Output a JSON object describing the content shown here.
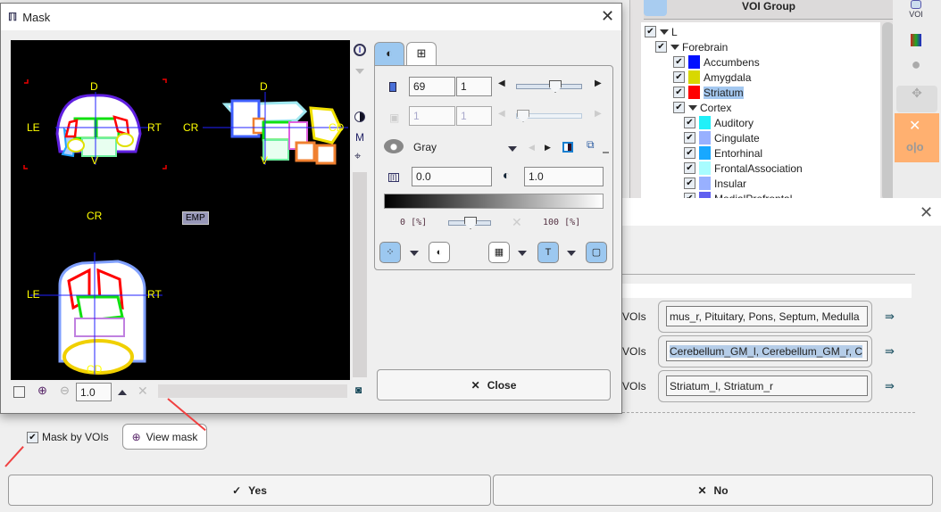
{
  "voi_panel": {
    "header": "VOI Group",
    "tree": [
      {
        "label": "L",
        "level": 0,
        "checked": true,
        "expanded": true
      },
      {
        "label": "Forebrain",
        "level": 1,
        "checked": true,
        "expanded": true
      },
      {
        "label": "Accumbens",
        "level": 2,
        "checked": true,
        "color": "#0010ff"
      },
      {
        "label": "Amygdala",
        "level": 2,
        "checked": true,
        "color": "#d8d800"
      },
      {
        "label": "Striatum",
        "level": 2,
        "checked": true,
        "color": "#ff0000",
        "selected": true
      },
      {
        "label": "Cortex",
        "level": 2,
        "checked": true,
        "expanded": true
      },
      {
        "label": "Auditory",
        "level": 3,
        "checked": true,
        "color": "#20f0f8"
      },
      {
        "label": "Cingulate",
        "level": 3,
        "checked": true,
        "color": "#98b0ff"
      },
      {
        "label": "Entorhinal",
        "level": 3,
        "checked": true,
        "color": "#18a8ff"
      },
      {
        "label": "FrontalAssociation",
        "level": 3,
        "checked": true,
        "color": "#a8fcff"
      },
      {
        "label": "Insular",
        "level": 3,
        "checked": true,
        "color": "#98b0ff"
      },
      {
        "label": "MedialPrefrontal",
        "level": 3,
        "checked": true,
        "color": "#6060f0"
      }
    ],
    "side_icons": [
      "voi-icon",
      "colormap-icon",
      "brain-icon",
      "move-voi-icon",
      "delete-icon",
      "split-icon"
    ],
    "voi_icon_label": "VOI",
    "highlight_color": "#ffb070"
  },
  "bg_dialog": {
    "voi_rows": [
      {
        "label": "VOIs",
        "value": "mus_r, Pituitary, Pons, Septum, Medulla",
        "highlighted": false
      },
      {
        "label": "VOIs",
        "value": "Cerebellum_GM_l, Cerebellum_GM_r, C",
        "highlighted": true
      },
      {
        "label": "VOIs",
        "value": "Striatum_l, Striatum_r",
        "highlighted": false
      }
    ],
    "mask_by_vois_label": "Mask by VOIs",
    "mask_by_vois_checked": true,
    "view_mask_label": "View mask",
    "yes_label": "Yes",
    "no_label": "No"
  },
  "mask_dialog": {
    "title": "Mask",
    "viewer": {
      "coronal": {
        "top": "D",
        "bottom": "V",
        "left": "LE",
        "right": "RT"
      },
      "sagittal": {
        "top": "D",
        "bottom": "V",
        "left": "CR",
        "right": "CD"
      },
      "axial": {
        "top": "CR",
        "bottom": "CD",
        "left": "LE",
        "right": "RT"
      },
      "empty_badge": "EMP"
    },
    "right_strip_m": "M",
    "zoom_value": "1.0",
    "panel": {
      "slice_value": "69",
      "slice_step": "1",
      "slice_slider": 0.6,
      "frame_value": "1",
      "frame_step": "1",
      "frame_slider": 0.0,
      "colormap": "Gray",
      "min_value": "0.0",
      "max_value": "1.0",
      "lower_pct": "0",
      "upper_pct": "100",
      "pct_unit": "[%]",
      "threshold_slider": 0.5
    },
    "close_label": "Close"
  }
}
